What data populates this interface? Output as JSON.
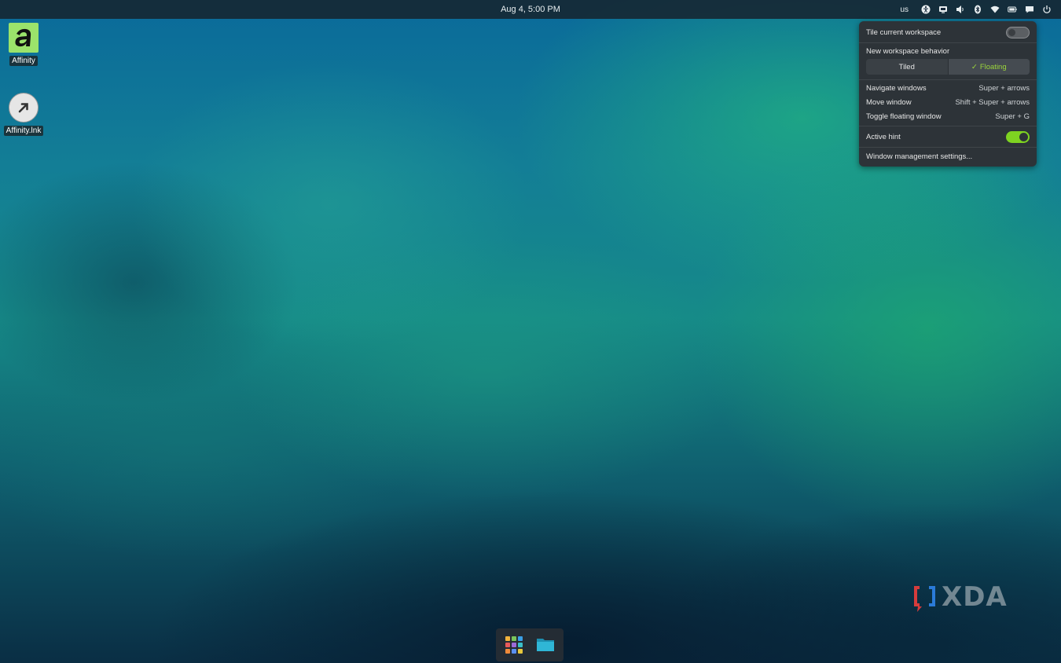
{
  "topbar": {
    "clock": "Aug 4, 5:00 PM",
    "keyboard_layout": "us",
    "tray_icons": [
      "accessibility-icon",
      "screen-share-icon",
      "volume-icon",
      "bluetooth-icon",
      "wifi-icon",
      "battery-icon",
      "notifications-icon",
      "power-icon"
    ]
  },
  "desktop_icons": [
    {
      "label": "Affinity",
      "icon": "affinity-icon"
    },
    {
      "label": "Affinity.lnk",
      "icon": "shortcut-arrow-icon"
    }
  ],
  "popup": {
    "tile_current_workspace": {
      "label": "Tile current workspace",
      "enabled": false
    },
    "new_workspace_behavior": {
      "label": "New workspace behavior",
      "options": [
        "Tiled",
        "Floating"
      ],
      "selected": "Floating"
    },
    "shortcuts": [
      {
        "label": "Navigate windows",
        "keys": "Super + arrows"
      },
      {
        "label": "Move window",
        "keys": "Shift + Super + arrows"
      },
      {
        "label": "Toggle floating window",
        "keys": "Super + G"
      }
    ],
    "active_hint": {
      "label": "Active hint",
      "enabled": true
    },
    "settings_link": "Window management settings..."
  },
  "dock": {
    "items": [
      "app-grid-icon",
      "files-folder-icon"
    ]
  },
  "watermark": {
    "text": "XDA"
  },
  "colors": {
    "accent": "#7ed321",
    "popup_bg": "#2d3338",
    "topbar_bg": "#16283a"
  }
}
